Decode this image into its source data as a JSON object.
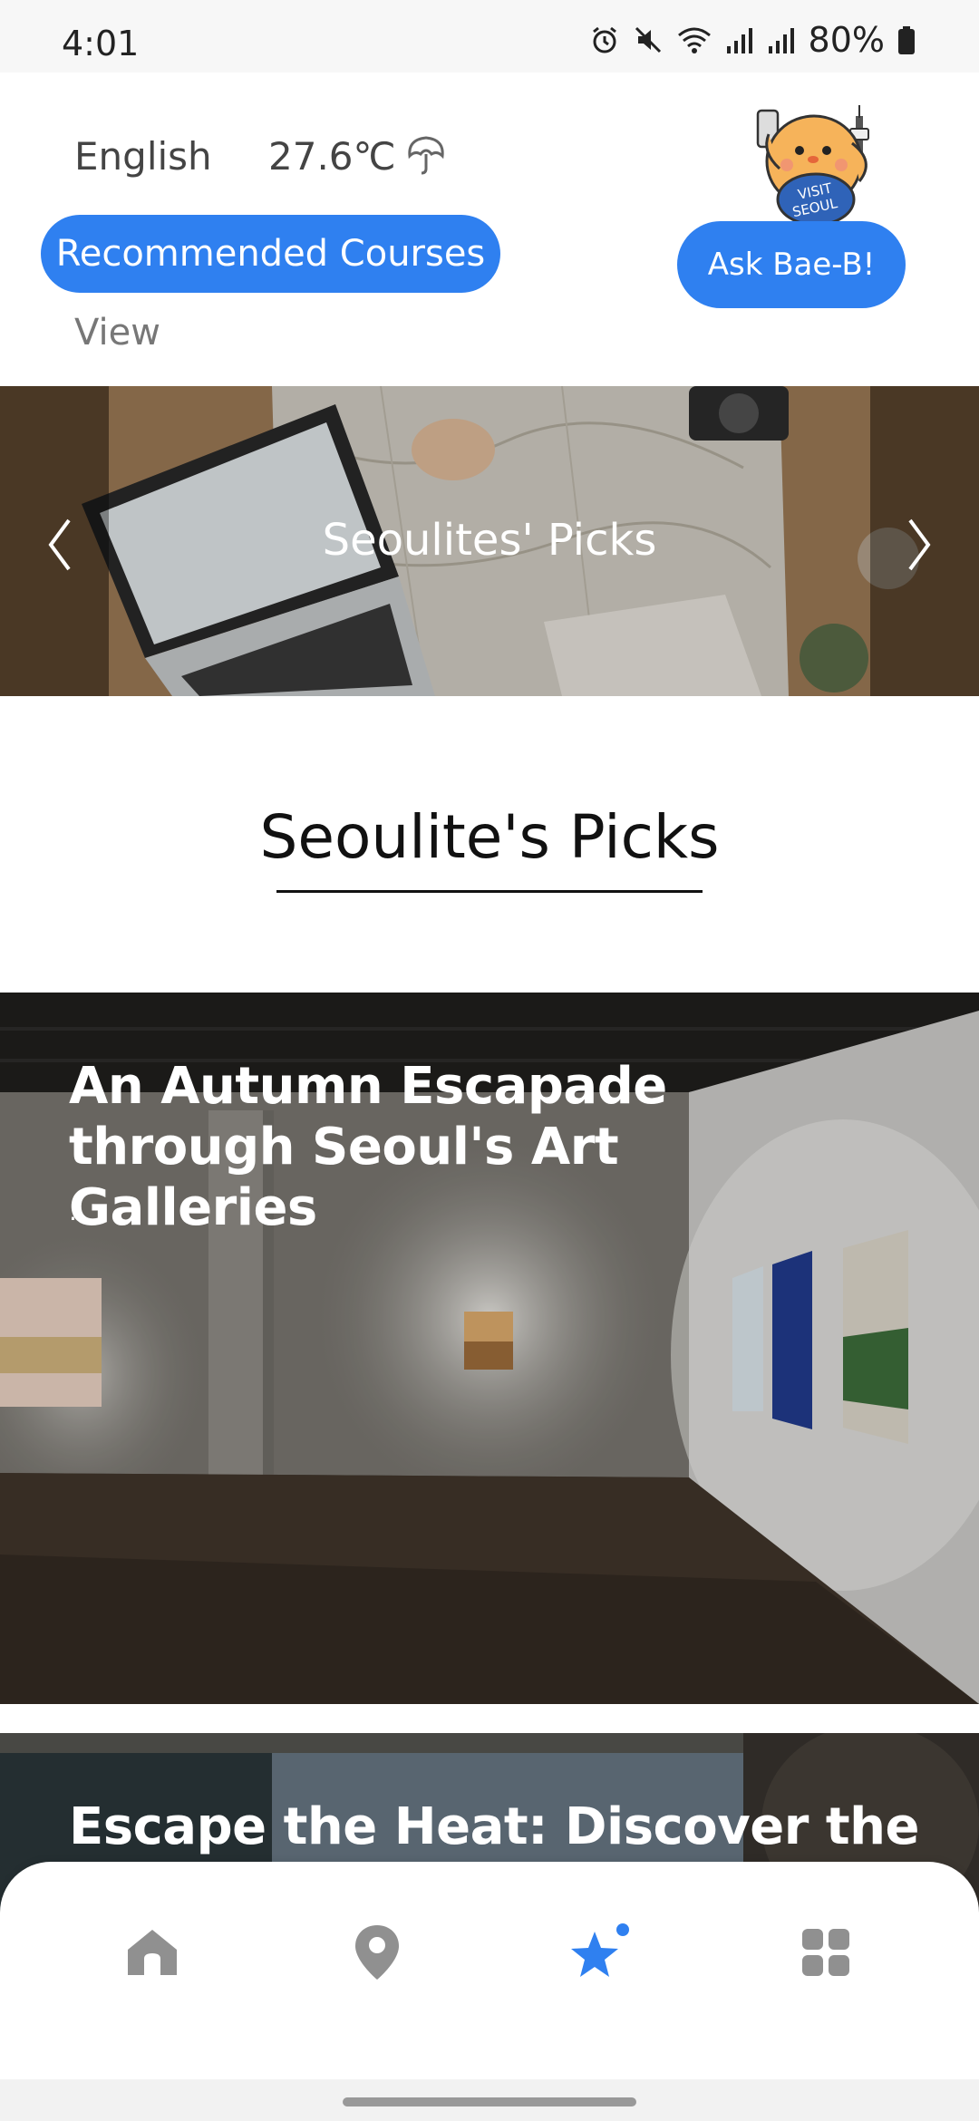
{
  "status_bar": {
    "time": "4:01",
    "battery": "80%",
    "icons": [
      "alarm-icon",
      "mute-icon",
      "wifi-icon",
      "signal-icon",
      "signal-icon",
      "battery-icon"
    ]
  },
  "header": {
    "language": "English",
    "temperature": "27.6℃",
    "weather_icon": "umbrella-icon",
    "recommended_button": "Recommended Courses",
    "view_link": "View",
    "mascot_text": "VISIT SEOUL",
    "ask_button": "Ask Bae-B!"
  },
  "banner": {
    "title": "Seoulites' Picks",
    "prev_icon": "chevron-left-icon",
    "next_icon": "chevron-right-icon"
  },
  "section": {
    "title": "Seoulite's Picks"
  },
  "cards": [
    {
      "title": "An Autumn Escapade through Seoul's Art Galleries",
      "subtitle": "."
    },
    {
      "title": "Escape the Heat: Discover the"
    }
  ],
  "bottom_nav": {
    "items": [
      "home-icon",
      "location-pin-icon",
      "star-icon",
      "grid-icon"
    ],
    "active": "star-icon",
    "active_color": "#2f80f0"
  },
  "colors": {
    "accent": "#2f80f0"
  }
}
